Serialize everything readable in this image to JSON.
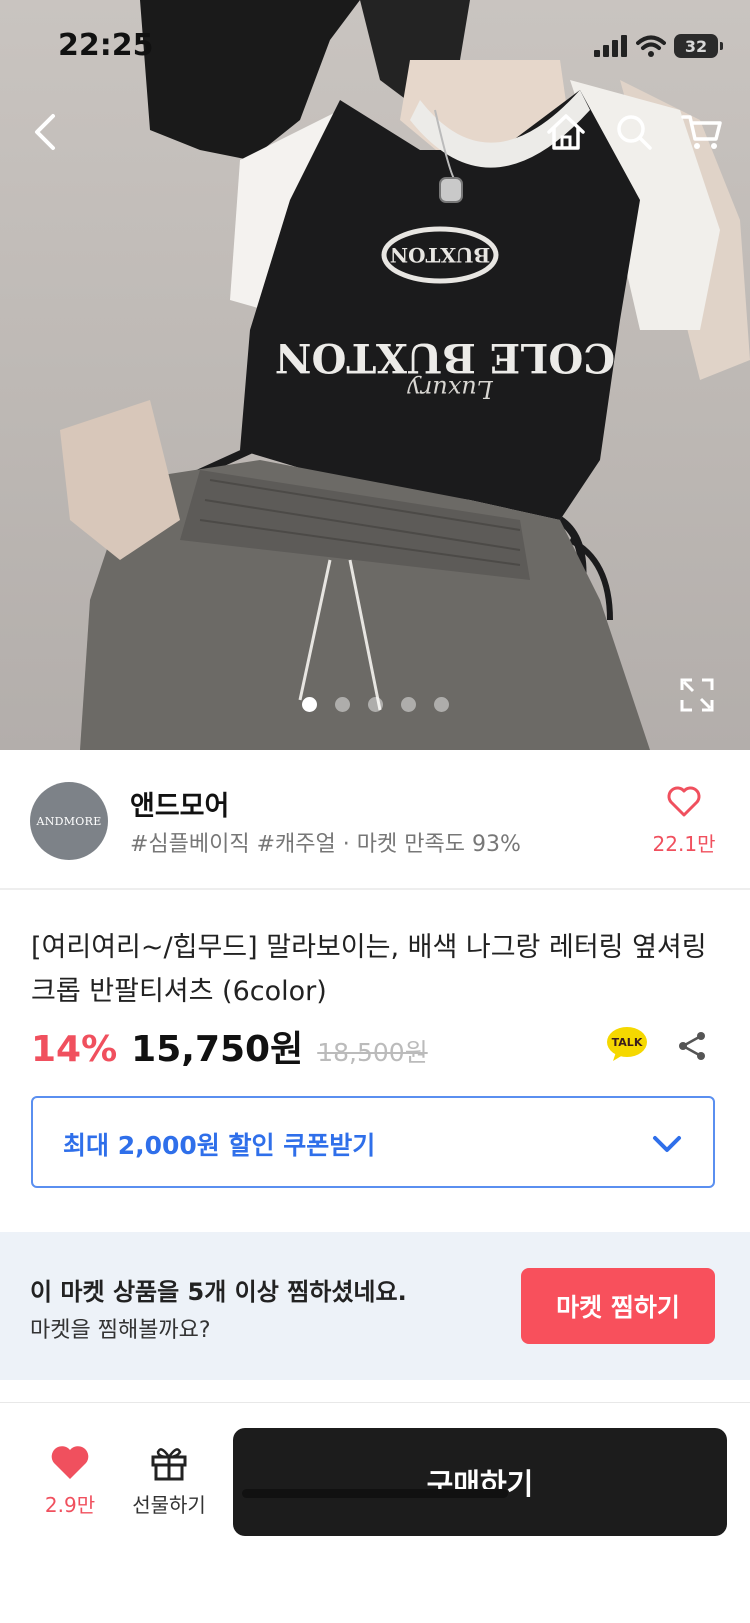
{
  "status": {
    "time": "22:25",
    "battery": "32"
  },
  "hero": {
    "shirt_print": {
      "line1": "COLE BUXTON",
      "small": "BUXTON",
      "script": "Luxury"
    },
    "image_count": 5,
    "active_image": 1
  },
  "icons": {
    "back": "chevron-left-icon",
    "home": "home-icon",
    "search": "search-icon",
    "cart": "cart-icon",
    "expand": "expand-icon",
    "heart": "heart-icon",
    "talk": "kakao-talk-icon",
    "share": "share-icon",
    "coupon_chevron": "chevron-down-icon",
    "gift": "gift-icon"
  },
  "seller": {
    "logo_text": "ANDMORE",
    "name": "앤드모어",
    "tags": "#심플베이직 #캐주얼 · 마켓 만족도 93%",
    "favorite_count": "22.1만"
  },
  "product": {
    "title": "[여리여리~/힙무드] 말라보이는, 배색 나그랑 레터링 옆셔링 크롭 반팔티셔츠 (6color)",
    "discount": "14%",
    "price": "15,750원",
    "original_price": "18,500원",
    "talk_label": "TALK"
  },
  "coupon": {
    "label": "최대 2,000원 할인 쿠폰받기"
  },
  "banner": {
    "headline": "이 마켓 상품을 5개 이상 찜하셨네요.",
    "subline": "마켓을 찜해볼까요?",
    "button": "마켓 찜하기"
  },
  "bottom_bar": {
    "like_count": "2.9만",
    "gift_label": "선물하기",
    "buy_label": "구매하기"
  },
  "colors": {
    "accent_red": "#f0505e",
    "coupon_blue": "#2f6fea",
    "banner_bg": "#edf2f8",
    "buy_button": "#1c1c1c"
  }
}
